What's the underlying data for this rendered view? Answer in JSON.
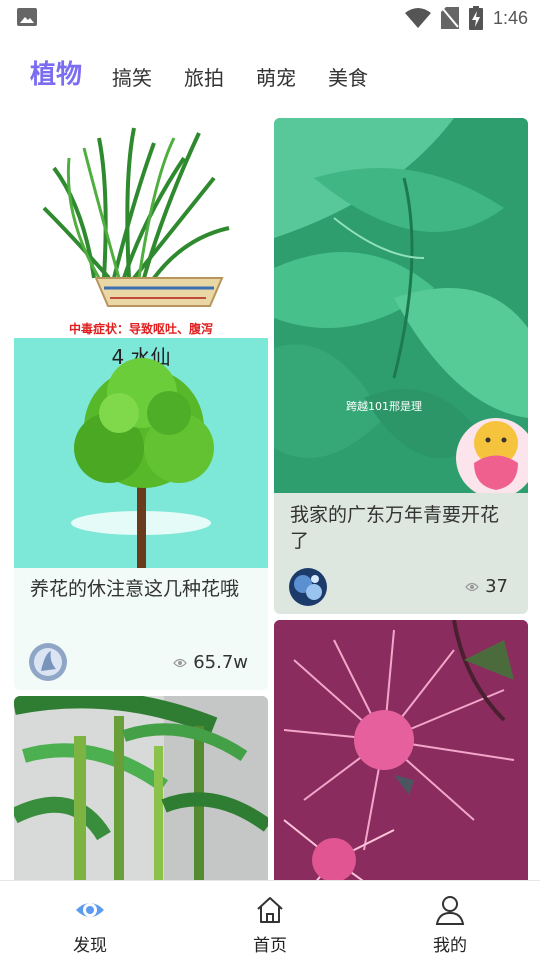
{
  "status_bar": {
    "time": "1:46"
  },
  "tabs": [
    {
      "label": "植物",
      "active": true
    },
    {
      "label": "搞笑",
      "active": false
    },
    {
      "label": "旅拍",
      "active": false
    },
    {
      "label": "萌宠",
      "active": false
    },
    {
      "label": "美食",
      "active": false
    }
  ],
  "cards": [
    {
      "title": "养花的休注意这几种花哦",
      "views": "65.7w",
      "image_text": [
        "中毒症状：导致呕吐、腹泻",
        "4.水仙"
      ]
    },
    {
      "title": "我家的广东万年青要开花了",
      "views": "37",
      "image_text": [
        "跨越101邢是理"
      ]
    },
    {
      "title": "",
      "views": ""
    },
    {
      "title": "",
      "views": ""
    }
  ],
  "bottom_nav": [
    {
      "label": "发现",
      "icon": "eye-icon",
      "active": true
    },
    {
      "label": "首页",
      "icon": "home-icon",
      "active": false
    },
    {
      "label": "我的",
      "icon": "user-icon",
      "active": false
    }
  ],
  "colors": {
    "accent": "#7b6cf0",
    "card1_bg": "#f3fbf9",
    "card2_bg": "#dde7e0"
  }
}
